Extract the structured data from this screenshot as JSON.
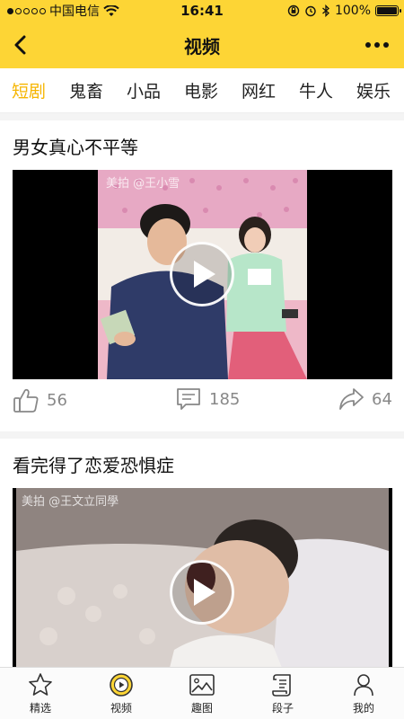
{
  "status_bar": {
    "carrier": "中国电信",
    "time": "16:41",
    "battery_percent": "100%"
  },
  "nav": {
    "title": "视频"
  },
  "category_tabs": [
    {
      "label": "短剧",
      "active": true
    },
    {
      "label": "鬼畜",
      "active": false
    },
    {
      "label": "小品",
      "active": false
    },
    {
      "label": "电影",
      "active": false
    },
    {
      "label": "网红",
      "active": false
    },
    {
      "label": "牛人",
      "active": false
    },
    {
      "label": "娱乐",
      "active": false
    }
  ],
  "feed": [
    {
      "title": "男女真心不平等",
      "watermark": "美拍 @王小雪",
      "likes": "56",
      "comments": "185",
      "shares": "64"
    },
    {
      "title": "看完得了恋爱恐惧症",
      "watermark": "美拍 @王文立同學"
    }
  ],
  "tab_bar": [
    {
      "label": "精选",
      "icon": "star-icon"
    },
    {
      "label": "视频",
      "icon": "play-circle-icon",
      "active": true
    },
    {
      "label": "趣图",
      "icon": "image-icon"
    },
    {
      "label": "段子",
      "icon": "scroll-icon"
    },
    {
      "label": "我的",
      "icon": "person-icon"
    }
  ],
  "colors": {
    "accent": "#fdd535",
    "active_tab": "#f6b500"
  }
}
